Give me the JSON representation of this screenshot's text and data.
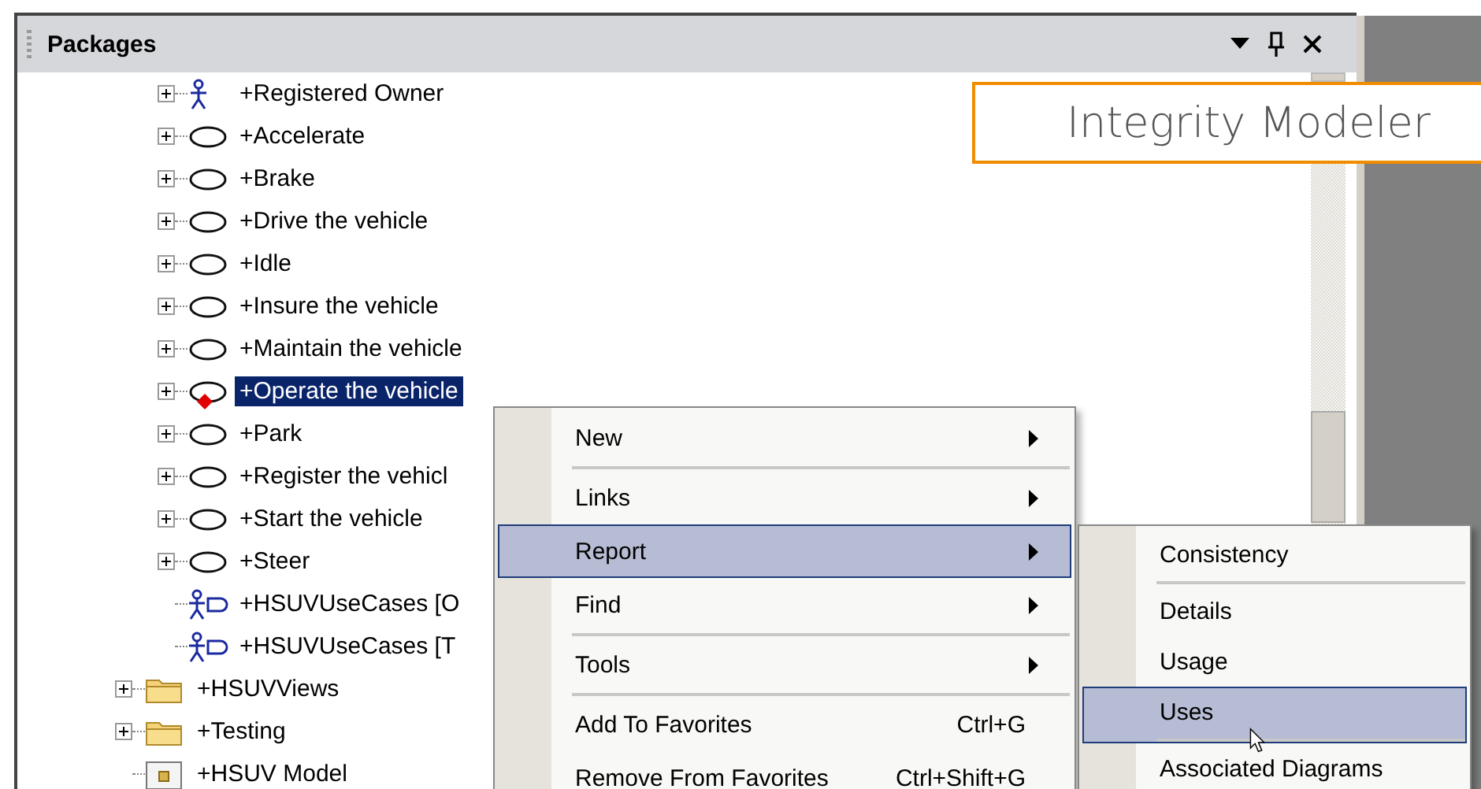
{
  "panel": {
    "title": "Packages"
  },
  "overlay_label": "Integrity Modeler",
  "tree": [
    {
      "children": [
        {
          "kind": "actor",
          "label": "+Registered Owner",
          "expandable": true,
          "selected": false,
          "flagged": false
        },
        {
          "kind": "usecase",
          "label": "+Accelerate",
          "expandable": true,
          "selected": false,
          "flagged": false
        },
        {
          "kind": "usecase",
          "label": "+Brake",
          "expandable": true,
          "selected": false,
          "flagged": false
        },
        {
          "kind": "usecase",
          "label": "+Drive the vehicle",
          "expandable": true,
          "selected": false,
          "flagged": false
        },
        {
          "kind": "usecase",
          "label": "+Idle",
          "expandable": true,
          "selected": false,
          "flagged": false
        },
        {
          "kind": "usecase",
          "label": "+Insure the vehicle",
          "expandable": true,
          "selected": false,
          "flagged": false
        },
        {
          "kind": "usecase",
          "label": "+Maintain the vehicle",
          "expandable": true,
          "selected": false,
          "flagged": false
        },
        {
          "kind": "usecase",
          "label": "+Operate the vehicle",
          "expandable": true,
          "selected": true,
          "flagged": true
        },
        {
          "kind": "usecase",
          "label": "+Park",
          "expandable": true,
          "selected": false,
          "flagged": false
        },
        {
          "kind": "usecase",
          "label": "+Register the vehicl",
          "expandable": true,
          "selected": false,
          "flagged": false
        },
        {
          "kind": "usecase",
          "label": "+Start the vehicle",
          "expandable": true,
          "selected": false,
          "flagged": false
        },
        {
          "kind": "usecase",
          "label": "+Steer",
          "expandable": true,
          "selected": false,
          "flagged": false
        },
        {
          "kind": "diagram",
          "label": "+HSUVUseCases [O",
          "expandable": false,
          "selected": false,
          "flagged": false
        },
        {
          "kind": "diagram",
          "label": "+HSUVUseCases [T",
          "expandable": false,
          "selected": false,
          "flagged": false
        }
      ]
    },
    {
      "kind": "folder",
      "label": "+HSUVViews",
      "expandable": true,
      "selected": false,
      "flagged": false
    },
    {
      "kind": "folder",
      "label": "+Testing",
      "expandable": true,
      "selected": false,
      "flagged": false
    },
    {
      "kind": "model",
      "label": "+HSUV Model",
      "expandable": false,
      "selected": false,
      "flagged": false
    }
  ],
  "context_menu": [
    {
      "label": "New",
      "submenu": true,
      "selected": false,
      "separator_after": true
    },
    {
      "label": "Links",
      "submenu": true,
      "selected": false,
      "separator_after": false
    },
    {
      "label": "Report",
      "submenu": true,
      "selected": true,
      "separator_after": false
    },
    {
      "label": "Find",
      "submenu": true,
      "selected": false,
      "separator_after": true
    },
    {
      "label": "Tools",
      "submenu": true,
      "selected": false,
      "separator_after": true
    },
    {
      "label": "Add To Favorites",
      "submenu": false,
      "shortcut": "Ctrl+G",
      "selected": false,
      "separator_after": false
    },
    {
      "label": "Remove From Favorites",
      "submenu": false,
      "shortcut": "Ctrl+Shift+G",
      "selected": false
    }
  ],
  "submenu": [
    {
      "label": "Consistency",
      "selected": false,
      "separator_after": true
    },
    {
      "label": "Details",
      "selected": false,
      "separator_after": false
    },
    {
      "label": "Usage",
      "selected": false,
      "separator_after": false
    },
    {
      "label": "Uses",
      "selected": true,
      "separator_after": true
    },
    {
      "label": "Associated Diagrams",
      "selected": false
    }
  ]
}
